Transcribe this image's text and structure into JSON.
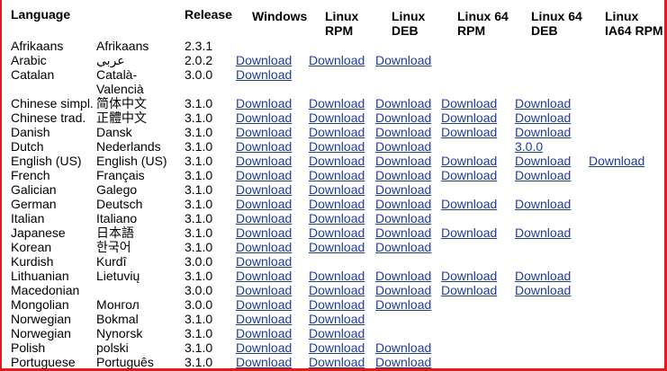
{
  "headers": {
    "language": "Language",
    "native": "",
    "release": "Release",
    "windows": "Windows",
    "linux_rpm": "Linux\nRPM",
    "linux_deb": "Linux\nDEB",
    "linux64_rpm": "Linux 64\nRPM",
    "linux64_deb": "Linux 64\nDEB",
    "linux_ia64_rpm": "Linux\nIA64 RPM"
  },
  "rows": [
    {
      "lang": "Afrikaans",
      "native": "Afrikaans",
      "release": "2.3.1",
      "win": "",
      "rpm": "",
      "deb": "",
      "rpm64": "",
      "deb64": "",
      "ia64": ""
    },
    {
      "lang": "Arabic",
      "native": "عربي",
      "release": "2.0.2",
      "win": "Download",
      "rpm": "Download",
      "deb": "Download",
      "rpm64": "",
      "deb64": "",
      "ia64": ""
    },
    {
      "lang": "Catalan",
      "native": "Català-\nValencià",
      "release": "3.0.0",
      "win": "Download",
      "rpm": "",
      "deb": "",
      "rpm64": "",
      "deb64": "",
      "ia64": ""
    },
    {
      "lang": "Chinese simpl.",
      "native": "简体中文",
      "release": "3.1.0",
      "win": "Download",
      "rpm": "Download",
      "deb": "Download",
      "rpm64": "Download",
      "deb64": "Download",
      "ia64": ""
    },
    {
      "lang": "Chinese trad.",
      "native": "正體中文",
      "release": "3.1.0",
      "win": "Download",
      "rpm": "Download",
      "deb": "Download",
      "rpm64": "Download",
      "deb64": "Download",
      "ia64": ""
    },
    {
      "lang": "Danish",
      "native": "Dansk",
      "release": "3.1.0",
      "win": "Download",
      "rpm": "Download",
      "deb": "Download",
      "rpm64": "Download",
      "deb64": "Download",
      "ia64": ""
    },
    {
      "lang": "Dutch",
      "native": "Nederlands",
      "release": "3.1.0",
      "win": "Download",
      "rpm": "Download",
      "deb": "Download",
      "rpm64": "",
      "deb64": "3.0.0",
      "ia64": ""
    },
    {
      "lang": "English (US)",
      "native": "English (US)",
      "release": "3.1.0",
      "win": "Download",
      "rpm": "Download",
      "deb": "Download",
      "rpm64": "Download",
      "deb64": "Download",
      "ia64": "Download"
    },
    {
      "lang": "French",
      "native": "Français",
      "release": "3.1.0",
      "win": "Download",
      "rpm": "Download",
      "deb": "Download",
      "rpm64": "Download",
      "deb64": "Download",
      "ia64": ""
    },
    {
      "lang": "Galician",
      "native": "Galego",
      "release": "3.1.0",
      "win": "Download",
      "rpm": "Download",
      "deb": "Download",
      "rpm64": "",
      "deb64": "",
      "ia64": ""
    },
    {
      "lang": "German",
      "native": "Deutsch",
      "release": "3.1.0",
      "win": "Download",
      "rpm": "Download",
      "deb": "Download",
      "rpm64": "Download",
      "deb64": "Download",
      "ia64": ""
    },
    {
      "lang": "Italian",
      "native": "Italiano",
      "release": "3.1.0",
      "win": "Download",
      "rpm": "Download",
      "deb": "Download",
      "rpm64": "",
      "deb64": "",
      "ia64": ""
    },
    {
      "lang": "Japanese",
      "native": "日本語",
      "release": "3.1.0",
      "win": "Download",
      "rpm": "Download",
      "deb": "Download",
      "rpm64": "Download",
      "deb64": "Download",
      "ia64": ""
    },
    {
      "lang": "Korean",
      "native": "한국어",
      "release": "3.1.0",
      "win": "Download",
      "rpm": "Download",
      "deb": "Download",
      "rpm64": "",
      "deb64": "",
      "ia64": ""
    },
    {
      "lang": "Kurdish",
      "native": "Kurdî",
      "release": "3.0.0",
      "win": "Download",
      "rpm": "",
      "deb": "",
      "rpm64": "",
      "deb64": "",
      "ia64": ""
    },
    {
      "lang": "Lithuanian",
      "native": "Lietuvių",
      "release": "3.1.0",
      "win": "Download",
      "rpm": "Download",
      "deb": "Download",
      "rpm64": "Download",
      "deb64": "Download",
      "ia64": ""
    },
    {
      "lang": "Macedonian",
      "native": "",
      "release": "3.0.0",
      "win": "Download",
      "rpm": "Download",
      "deb": "Download",
      "rpm64": "Download",
      "deb64": "Download",
      "ia64": ""
    },
    {
      "lang": "Mongolian",
      "native": "Монгол",
      "release": "3.0.0",
      "win": "Download",
      "rpm": "Download",
      "deb": "Download",
      "rpm64": "",
      "deb64": "",
      "ia64": ""
    },
    {
      "lang": "Norwegian",
      "native": "Bokmal",
      "release": "3.1.0",
      "win": "Download",
      "rpm": "Download",
      "deb": "",
      "rpm64": "",
      "deb64": "",
      "ia64": ""
    },
    {
      "lang": "Norwegian",
      "native": "Nynorsk",
      "release": "3.1.0",
      "win": "Download",
      "rpm": "Download",
      "deb": "",
      "rpm64": "",
      "deb64": "",
      "ia64": ""
    },
    {
      "lang": "Polish",
      "native": "polski",
      "release": "3.1.0",
      "win": "Download",
      "rpm": "Download",
      "deb": "Download",
      "rpm64": "",
      "deb64": "",
      "ia64": ""
    },
    {
      "lang": "Portuguese",
      "native": "Português",
      "release": "3.1.0",
      "win": "Download",
      "rpm": "Download",
      "deb": "Download",
      "rpm64": "",
      "deb64": "",
      "ia64": ""
    }
  ],
  "colors": {
    "link": "#1f3c9c",
    "frame": "#e31b1b"
  }
}
